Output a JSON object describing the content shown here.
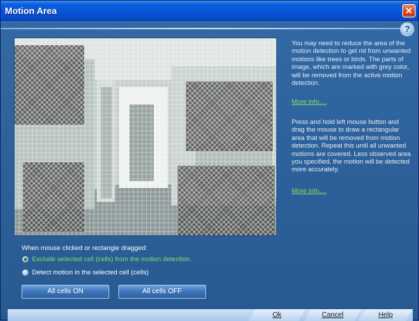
{
  "window": {
    "title": "Motion Area"
  },
  "title_controls": {
    "close_glyph": "✕",
    "help_glyph": "?"
  },
  "info": {
    "paragraph1": "You may need to reduce the area of the motion detection to get rid from unwanted motions like trees or birds. The parts of image, which are marked with grey color, will be removed from the active motion detection.",
    "more_info_1": "More info....",
    "paragraph2": "Press and hold left mouse button and drag the mouse to draw a rectangular area that will be removed from motion detection. Repeat this until all unwanted motions are covered. Less observed area you specified, the motion will be detected more accurately.",
    "more_info_2": "More info...."
  },
  "options": {
    "label": "When mouse clicked or rectangle dragged:",
    "exclude": {
      "text": "Exclude selected cell (cells) from the motion detection.",
      "checked": true
    },
    "detect": {
      "text": "Detect motion in the selected cell (cells)",
      "checked": false
    }
  },
  "buttons": {
    "all_on": "All cells ON",
    "all_off": "All cells OFF"
  },
  "footer": {
    "ok": "Ok",
    "cancel": "Cancel",
    "help": "Help"
  },
  "colors": {
    "accent_green": "#7fe06a",
    "panel_blue": "#2d6099",
    "title_blue": "#0553d6"
  },
  "icons": [
    "close-icon",
    "help-icon",
    "radio-checked-icon",
    "radio-unchecked-icon"
  ]
}
